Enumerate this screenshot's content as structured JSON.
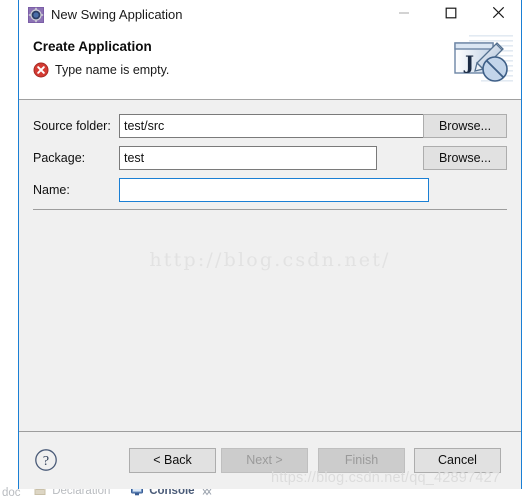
{
  "window": {
    "title": "New Swing Application",
    "icon": "swing-app-icon",
    "controls": {
      "minimize": "minimize-icon",
      "maximize": "maximize-icon",
      "close": "close-icon"
    }
  },
  "header": {
    "title": "Create Application",
    "message": "Type name is empty.",
    "message_icon": "error-icon",
    "banner_icon": "java-swing-wizard-icon"
  },
  "form": {
    "fields": [
      {
        "label": "Source folder:",
        "value": "test/src",
        "placeholder": "",
        "focused": false,
        "browse_label": "Browse...",
        "has_browse": true
      },
      {
        "label": "Package:",
        "value": "test",
        "placeholder": "",
        "focused": false,
        "browse_label": "Browse...",
        "has_browse": true
      },
      {
        "label": "Name:",
        "value": "",
        "placeholder": "",
        "focused": true,
        "browse_label": "",
        "has_browse": false
      }
    ]
  },
  "watermarks": {
    "body": "http://blog.csdn.net/",
    "footer": "https://blog.csdn.net/qq_42897427"
  },
  "footer": {
    "help_label": "?",
    "buttons": [
      {
        "label": "< Back",
        "enabled": true
      },
      {
        "label": "Next >",
        "enabled": false
      },
      {
        "label": "Finish",
        "enabled": false
      },
      {
        "label": "Cancel",
        "enabled": true
      }
    ]
  },
  "eclipse_background": {
    "tabs": [
      {
        "label": "doc",
        "icon": "",
        "active": false
      },
      {
        "label": "Declaration",
        "icon": "declaration-icon",
        "active": false
      },
      {
        "label": "Console",
        "icon": "console-icon",
        "active": true
      }
    ]
  },
  "colors": {
    "accent": "#1a7fd4",
    "dialog_bg": "#f0f0f0",
    "header_bg": "#ffffff",
    "error": "#d43b33",
    "button_bg": "#e1e1e1",
    "button_disabled_bg": "#cccccc"
  }
}
